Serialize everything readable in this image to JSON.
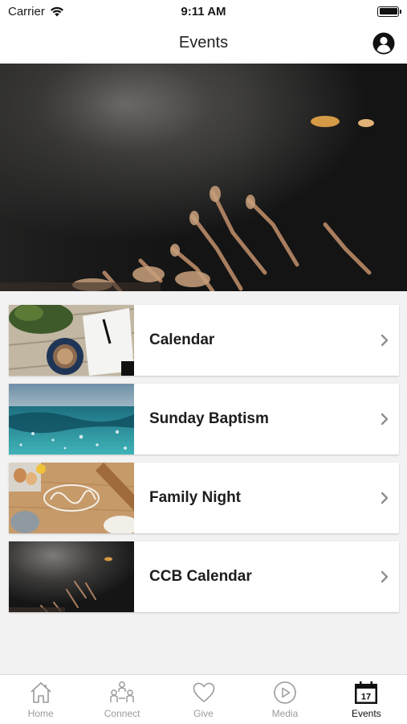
{
  "status_bar": {
    "carrier": "Carrier",
    "time": "9:11 AM"
  },
  "nav": {
    "title": "Events",
    "profile_icon": "profile-icon"
  },
  "hero": {
    "icon": "worship-hands-photo"
  },
  "events": [
    {
      "label": "Calendar",
      "thumb": "desk-notebook-photo"
    },
    {
      "label": "Sunday Baptism",
      "thumb": "water-photo"
    },
    {
      "label": "Family Night",
      "thumb": "family-flour-photo"
    },
    {
      "label": "CCB Calendar",
      "thumb": "worship-hands-photo"
    }
  ],
  "tabs": [
    {
      "label": "Home",
      "icon": "home-icon",
      "active": false
    },
    {
      "label": "Connect",
      "icon": "connect-icon",
      "active": false
    },
    {
      "label": "Give",
      "icon": "heart-icon",
      "active": false
    },
    {
      "label": "Media",
      "icon": "play-icon",
      "active": false
    },
    {
      "label": "Events",
      "icon": "calendar-icon",
      "active": true,
      "badge": "17"
    }
  ],
  "colors": {
    "tab_inactive": "#9b9b9b",
    "tab_active": "#111111",
    "background": "#f2f2f2"
  }
}
